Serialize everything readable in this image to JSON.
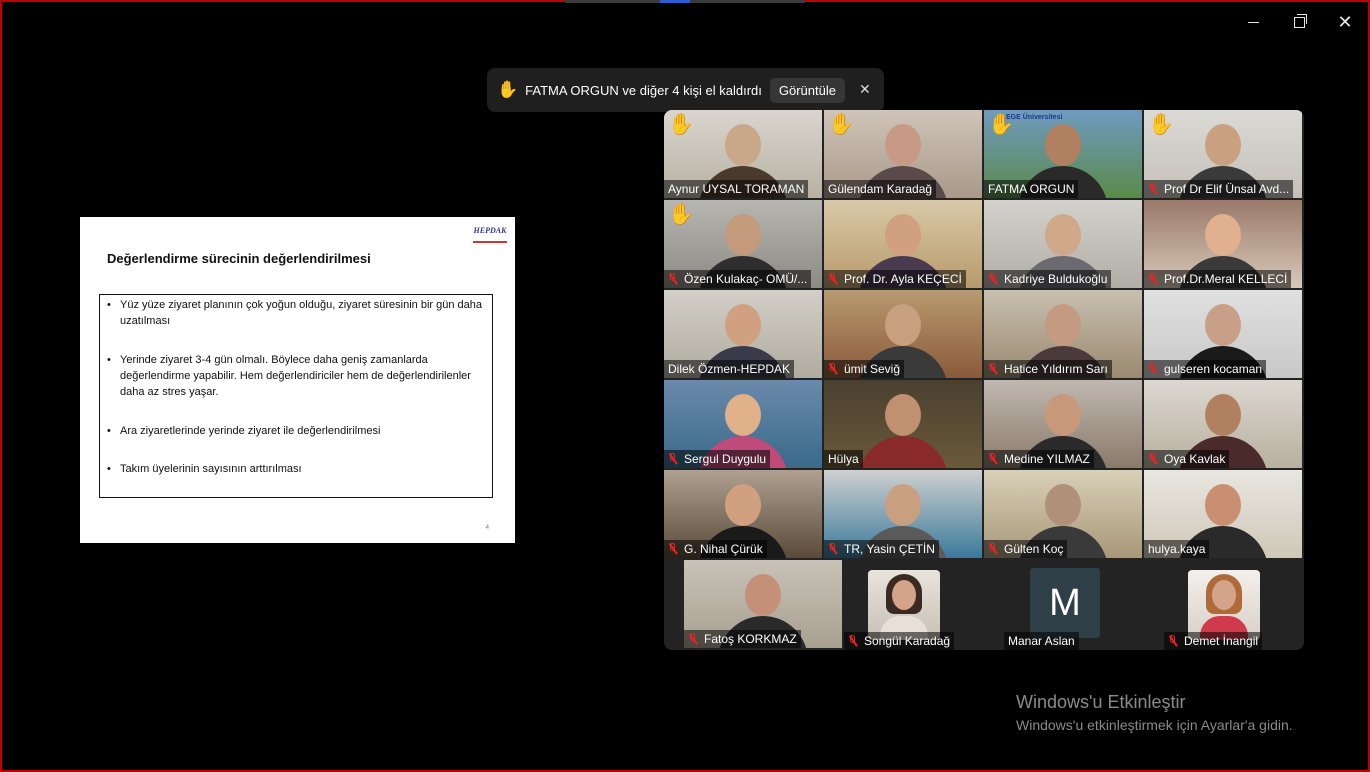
{
  "window": {
    "controls": {
      "minimize_icon": "minimize-icon",
      "maximize_icon": "restore-icon",
      "close_icon": "close-icon",
      "close_glyph": "✕"
    }
  },
  "notification": {
    "hand_glyph": "✋",
    "message": "FATMA ORGUN ve diğer 4 kişi el kaldırdı",
    "view_button": "Görüntüle",
    "close_glyph": "✕"
  },
  "slide": {
    "logo_text": "HEPDAK",
    "title": "Değerlendirme sürecinin değerlendirilmesi",
    "bullet_glyph": "•",
    "bullets": [
      "Yüz yüze ziyaret planının çok yoğun olduğu, ziyaret süresinin bir gün daha uzatılması",
      "Yerinde ziyaret 3-4 gün olmalı. Böylece daha geniş zamanlarda değerlendirme yapabilir. Hem değerlendiriciler hem de değerlendirilenler daha az stres yaşar.",
      "Ara ziyaretlerinde yerinde ziyaret ile değerlendirilmesi",
      "Takım üyelerinin sayısının arttırılması"
    ],
    "page_number": "4"
  },
  "participants": [
    {
      "name": "Aynur UYSAL TORAMAN",
      "muted": false,
      "hand": true,
      "active": true
    },
    {
      "name": "Gülendam Karadağ",
      "muted": false,
      "hand": true
    },
    {
      "name": "FATMA ORGUN",
      "muted": false,
      "hand": true
    },
    {
      "name": "Prof Dr Elif Ünsal Avd...",
      "muted": true,
      "hand": true
    },
    {
      "name": "Özen Kulakaç- OMÜ/...",
      "muted": true,
      "hand": true
    },
    {
      "name": "Prof. Dr. Ayla KEÇECİ",
      "muted": true,
      "hand": false
    },
    {
      "name": "Kadriye Buldukoğlu",
      "muted": true,
      "hand": false
    },
    {
      "name": "Prof.Dr.Meral KELLECİ",
      "muted": true,
      "hand": false
    },
    {
      "name": "Dilek Özmen-HEPDAK",
      "muted": false,
      "hand": false
    },
    {
      "name": "ümit Seviğ",
      "muted": true,
      "hand": false
    },
    {
      "name": "Hatice Yıldırım Sarı",
      "muted": true,
      "hand": false
    },
    {
      "name": "gulseren kocaman",
      "muted": true,
      "hand": false
    },
    {
      "name": "Sergul Duygulu",
      "muted": true,
      "hand": false
    },
    {
      "name": "Hülya",
      "muted": false,
      "hand": false
    },
    {
      "name": "Medine YILMAZ",
      "muted": true,
      "hand": false
    },
    {
      "name": "Oya Kavlak",
      "muted": true,
      "hand": false
    },
    {
      "name": "G. Nihal Çürük",
      "muted": true,
      "hand": false
    },
    {
      "name": "TR, Yasin ÇETİN",
      "muted": true,
      "hand": false
    },
    {
      "name": "Gülten Koç",
      "muted": true,
      "hand": false
    },
    {
      "name": "hulya.kaya",
      "muted": false,
      "hand": false
    },
    {
      "name": "Fatoş KORKMAZ",
      "muted": true,
      "hand": false
    },
    {
      "name": "Songül Karadağ",
      "muted": true,
      "hand": false
    },
    {
      "name": "Manar Aslan",
      "muted": false,
      "hand": false,
      "avatar_letter": "M"
    },
    {
      "name": "Demet İnangil",
      "muted": true,
      "hand": false
    }
  ],
  "tile_3_logo": "EGE Üniversitesi",
  "watermark": {
    "line1": "Windows'u Etkinleştir",
    "line2": "Windows'u etkinleştirmek için Ayarlar'a gidin."
  }
}
